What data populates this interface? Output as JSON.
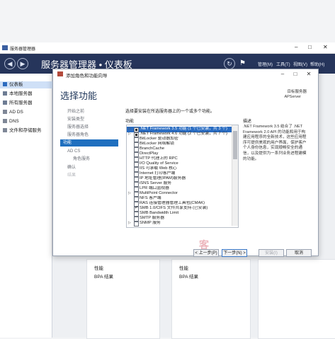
{
  "outer": {
    "titlebar_text": "服务器管理器",
    "header_title": "服务器管理器 • 仪表板",
    "menus": [
      "管理(M)",
      "工具(T)",
      "视图(V)",
      "帮助(H)"
    ],
    "sidebar": [
      "仪表板",
      "本地服务器",
      "所有服务器",
      "AD DS",
      "DNS",
      "文件和存储服务"
    ],
    "tiles": [
      {
        "line1": "性能",
        "line2": "BPA 结果"
      },
      {
        "line1": "性能",
        "line2": "BPA 结果"
      }
    ]
  },
  "dialog": {
    "title": "添加角色和功能向导",
    "heading": "选择功能",
    "server_label": "目标服务器",
    "server_name": "APServer",
    "steps": [
      {
        "label": "开始之前",
        "state": "normal"
      },
      {
        "label": "安装类型",
        "state": "normal"
      },
      {
        "label": "服务器选择",
        "state": "normal"
      },
      {
        "label": "服务器角色",
        "state": "normal"
      },
      {
        "label": "功能",
        "state": "active"
      },
      {
        "label": "AD CS",
        "state": "normal"
      },
      {
        "label": "角色服务",
        "state": "sub"
      },
      {
        "label": "确认",
        "state": "normal"
      },
      {
        "label": "结果",
        "state": "disabled"
      }
    ],
    "instruction": "选择要安装在所选服务器上的一个或多个功能。",
    "features_label": "功能",
    "features": [
      {
        "label": ".NET Framework 3.5 功能 (1 个已安装，共 3 个)",
        "check": "partial",
        "expand": "▷",
        "selected": true
      },
      {
        "label": ".NET Framework 4.6 功能 (2 个已安装，共 7 个)",
        "check": "partial",
        "expand": "▷",
        "selected": false
      },
      {
        "label": "BitLocker 驱动器加密",
        "check": "none",
        "expand": "",
        "selected": false
      },
      {
        "label": "BitLocker 网络解锁",
        "check": "none",
        "expand": "",
        "selected": false
      },
      {
        "label": "BranchCache",
        "check": "none",
        "expand": "",
        "selected": false
      },
      {
        "label": "DirectPlay",
        "check": "none",
        "expand": "",
        "selected": false
      },
      {
        "label": "HTTP 代理上的 RPC",
        "check": "none",
        "expand": "",
        "selected": false
      },
      {
        "label": "I/O Quality of Service",
        "check": "none",
        "expand": "",
        "selected": false
      },
      {
        "label": "IIS 可承载 Web 核心",
        "check": "none",
        "expand": "",
        "selected": false
      },
      {
        "label": "Internet 打印客户端",
        "check": "none",
        "expand": "",
        "selected": false
      },
      {
        "label": "IP 地址管理(IPAM)服务器",
        "check": "none",
        "expand": "",
        "selected": false
      },
      {
        "label": "iSNS Server 服务",
        "check": "none",
        "expand": "",
        "selected": false
      },
      {
        "label": "LPR 端口监视器",
        "check": "none",
        "expand": "",
        "selected": false
      },
      {
        "label": "MultiPoint Connector",
        "check": "none",
        "expand": "▷",
        "selected": false
      },
      {
        "label": "NFS 客户端",
        "check": "none",
        "expand": "",
        "selected": false
      },
      {
        "label": "RAS 连接管理器管理工具包(CMAK)",
        "check": "none",
        "expand": "",
        "selected": false
      },
      {
        "label": "SMB 1.0/CIFS 文件共享支持 (已安装)",
        "check": "checked",
        "expand": "",
        "selected": false
      },
      {
        "label": "SMB Bandwidth Limit",
        "check": "none",
        "expand": "",
        "selected": false
      },
      {
        "label": "SMTP 服务器",
        "check": "none",
        "expand": "",
        "selected": false
      },
      {
        "label": "SNMP 服务",
        "check": "none",
        "expand": "▷",
        "selected": false
      }
    ],
    "description_heading": "描述",
    "description": ".NET Framework 3.5 结合了 .NET Framework 2.0 API 的功能和用于构建应用程序的全新技术，这些应用程序可提供美观的用户界面，保护客户个人身份信息，实现顺畅安全的通信，以及提供为一系列业务进程建模的功能。",
    "buttons": {
      "prev": "< 上一步(P)",
      "next": "下一步(N) >",
      "install": "安装(I)",
      "cancel": "取消"
    },
    "watermark": "客"
  }
}
